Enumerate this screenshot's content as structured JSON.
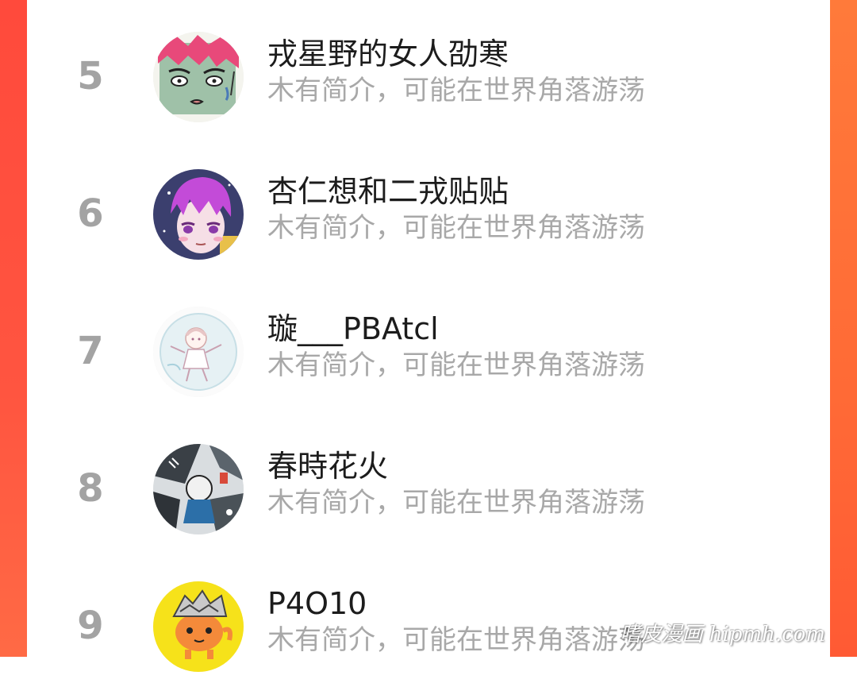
{
  "ranking": {
    "items": [
      {
        "rank": "5",
        "name": "戎星野的女人劭寒",
        "bio": "木有简介，可能在世界角落游荡",
        "avatar_icon": "anime-red-hair-avatar"
      },
      {
        "rank": "6",
        "name": "杏仁想和二戎贴贴",
        "bio": "木有简介，可能在世界角落游荡",
        "avatar_icon": "anime-purple-hair-avatar"
      },
      {
        "rank": "7",
        "name": "璇___PBAtcl",
        "bio": "木有简介，可能在世界角落游荡",
        "avatar_icon": "chibi-sketch-avatar"
      },
      {
        "rank": "8",
        "name": "春時花火",
        "bio": "木有简介，可能在世界角落游荡",
        "avatar_icon": "monochrome-collage-avatar"
      },
      {
        "rank": "9",
        "name": "P4O10",
        "bio": "木有简介，可能在世界角落游荡",
        "avatar_icon": "yellow-dog-avatar"
      }
    ]
  },
  "watermark": "嗜皮漫画 hipmh.com",
  "colors": {
    "side_accent": "#ff5540",
    "rank_gray": "#a3a3a3",
    "name_text": "#1c1c1c",
    "bio_text": "#a8a8a8"
  }
}
